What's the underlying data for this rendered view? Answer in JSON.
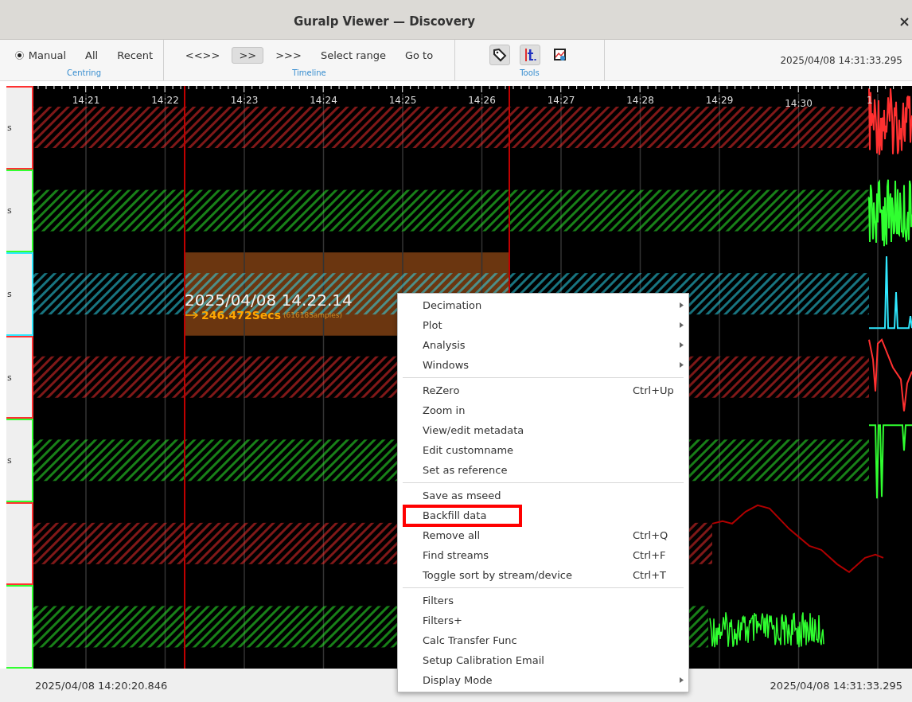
{
  "window": {
    "title": "Guralp Viewer — Discovery"
  },
  "toolbar": {
    "groups": [
      {
        "title": "Centring",
        "items": [
          {
            "kind": "radio",
            "label": "Manual",
            "selected": true
          },
          {
            "kind": "button",
            "label": "All",
            "selected": false
          },
          {
            "kind": "button",
            "label": "Recent",
            "selected": false
          }
        ]
      },
      {
        "title": "Timeline",
        "items": [
          {
            "kind": "button",
            "label": "<<>>",
            "selected": false
          },
          {
            "kind": "button",
            "label": ">>",
            "selected": true
          },
          {
            "kind": "button",
            "label": ">>>",
            "selected": false
          },
          {
            "kind": "button",
            "label": "Select range",
            "selected": false
          },
          {
            "kind": "button",
            "label": "Go to",
            "selected": false
          }
        ]
      },
      {
        "title": "Tools",
        "items": [
          {
            "kind": "tag",
            "selected": true
          },
          {
            "kind": "text",
            "selected": true
          },
          {
            "kind": "image",
            "selected": false
          }
        ]
      }
    ],
    "time": "2025/04/08 14:31:33.295"
  },
  "plot": {
    "ticks": [
      "14:21",
      "14:22",
      "14:23",
      "14:24",
      "14:25",
      "14:26",
      "14:27",
      "14:28",
      "14:29",
      "14:30",
      "1"
    ],
    "channels": [
      {
        "label": "s",
        "color": "#ff3030",
        "kind": "noise"
      },
      {
        "label": "s",
        "color": "#30ff30",
        "kind": "noise"
      },
      {
        "label": "s",
        "color": "#30e8ff",
        "kind": "spikes"
      },
      {
        "label": "s",
        "color": "#ff3030",
        "kind": "dip"
      },
      {
        "label": "s",
        "color": "#30ff30",
        "kind": "drop"
      },
      {
        "color": "#ff3030",
        "kind": "wave"
      },
      {
        "color": "#30ff30",
        "kind": "burst"
      }
    ],
    "selection": {
      "start": "2025/04/08 14.22.14",
      "duration": "246.472Secs",
      "samples": "(61618Samples)"
    }
  },
  "menu": {
    "groups": [
      {
        "items": [
          {
            "label": "Decimation",
            "submenu": true,
            "marked": false
          },
          {
            "label": "Plot",
            "submenu": true,
            "marked": false
          },
          {
            "label": "Analysis",
            "submenu": true,
            "marked": false
          },
          {
            "label": "Windows",
            "submenu": true,
            "marked": false
          }
        ]
      },
      {
        "items": [
          {
            "label": "ReZero",
            "shortcut": "Ctrl+Up",
            "submenu": false,
            "marked": false
          },
          {
            "label": "Zoom in",
            "submenu": false,
            "marked": false
          },
          {
            "label": "View/edit metadata",
            "submenu": false,
            "marked": false
          },
          {
            "label": "Edit customname",
            "submenu": false,
            "marked": false
          },
          {
            "label": "Set as reference",
            "submenu": false,
            "marked": false
          }
        ]
      },
      {
        "items": [
          {
            "label": "Save as mseed",
            "submenu": false,
            "marked": false
          },
          {
            "label": "Backfill data",
            "submenu": false,
            "marked": true
          },
          {
            "label": "Remove all",
            "shortcut": "Ctrl+Q",
            "submenu": false,
            "marked": false
          },
          {
            "label": "Find streams",
            "shortcut": "Ctrl+F",
            "submenu": false,
            "marked": false
          },
          {
            "label": "Toggle sort by stream/device",
            "shortcut": "Ctrl+T",
            "submenu": false,
            "marked": false
          }
        ]
      },
      {
        "items": [
          {
            "label": "Filters",
            "submenu": false,
            "marked": false
          },
          {
            "label": "Filters+",
            "submenu": false,
            "marked": false
          },
          {
            "label": "Calc Transfer Func",
            "submenu": false,
            "marked": false
          },
          {
            "label": "Setup Calibration Email",
            "submenu": false,
            "marked": false
          },
          {
            "label": "Display Mode",
            "submenu": true,
            "marked": false
          }
        ]
      }
    ]
  },
  "status_bar": {
    "start": "2025/04/08 14:20:20.846",
    "end": "2025/04/08 14:31:33.295"
  }
}
